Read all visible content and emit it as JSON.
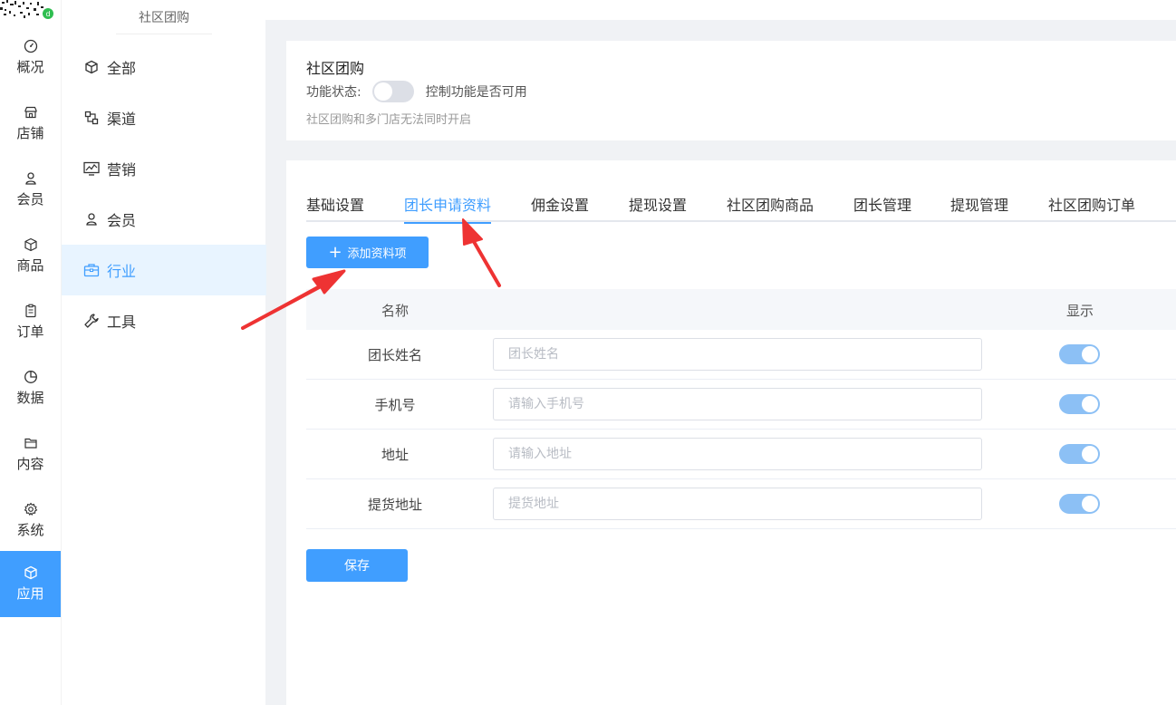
{
  "rail": {
    "items": [
      {
        "label": "概况",
        "icon": "dashboard-icon"
      },
      {
        "label": "店铺",
        "icon": "store-icon"
      },
      {
        "label": "会员",
        "icon": "user-icon"
      },
      {
        "label": "商品",
        "icon": "box-icon"
      },
      {
        "label": "订单",
        "icon": "clipboard-icon"
      },
      {
        "label": "数据",
        "icon": "pie-chart-icon"
      },
      {
        "label": "内容",
        "icon": "folder-icon"
      },
      {
        "label": "系统",
        "icon": "gear-icon"
      },
      {
        "label": "应用",
        "icon": "box-icon"
      }
    ],
    "active_index": 8
  },
  "submenu": {
    "title": "社区团购",
    "items": [
      {
        "label": "全部",
        "icon": "cube-icon"
      },
      {
        "label": "渠道",
        "icon": "channel-icon"
      },
      {
        "label": "营销",
        "icon": "marketing-chart-icon"
      },
      {
        "label": "会员",
        "icon": "user-icon"
      },
      {
        "label": "行业",
        "icon": "briefcase-icon"
      },
      {
        "label": "工具",
        "icon": "wrench-icon"
      }
    ],
    "active_index": 4
  },
  "feature": {
    "title": "社区团购",
    "status_label": "功能状态:",
    "status_on": false,
    "status_desc": "控制功能是否可用",
    "note": "社区团购和多门店无法同时开启"
  },
  "tabs": {
    "items": [
      "基础设置",
      "团长申请资料",
      "佣金设置",
      "提现设置",
      "社区团购商品",
      "团长管理",
      "提现管理",
      "社区团购订单"
    ],
    "active_index": 1
  },
  "add_button": {
    "label": "添加资料项",
    "icon": "plus-icon"
  },
  "table": {
    "headers": {
      "name": "名称",
      "show": "显示"
    },
    "rows": [
      {
        "name": "团长姓名",
        "placeholder": "团长姓名",
        "value": "",
        "show": true
      },
      {
        "name": "手机号",
        "placeholder": "请输入手机号",
        "value": "",
        "show": true
      },
      {
        "name": "地址",
        "placeholder": "请输入地址",
        "value": "",
        "show": true
      },
      {
        "name": "提货地址",
        "placeholder": "提货地址",
        "value": "",
        "show": true
      }
    ]
  },
  "save_button": {
    "label": "保存"
  },
  "colors": {
    "primary": "#409eff",
    "toggle_on": "#8cc0f5",
    "toggle_off": "#dcdfe6",
    "annotation_arrow": "#ee3333"
  }
}
